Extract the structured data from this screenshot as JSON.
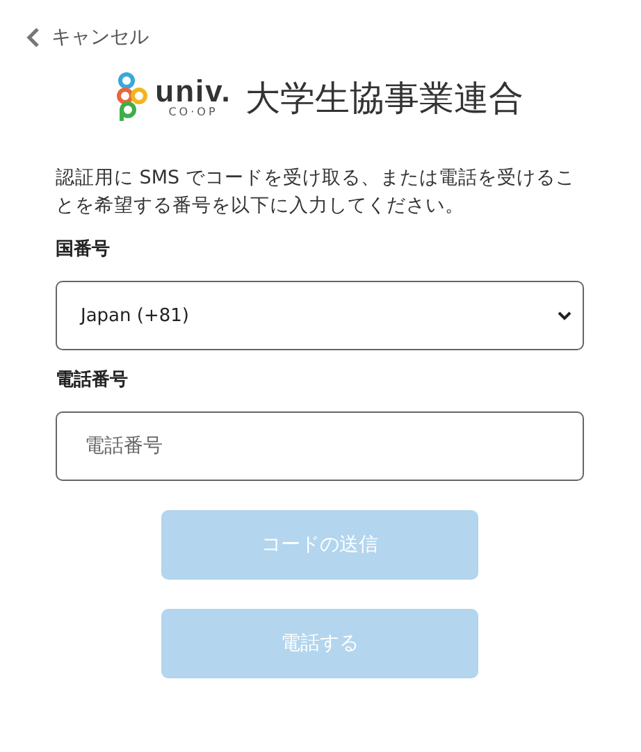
{
  "cancel_link": {
    "label": "キャンセル"
  },
  "logo": {
    "wordmark": "univ.",
    "subtext": "CO·OP",
    "name": "大学生協事業連合"
  },
  "instructions": "認証用に SMS でコードを受け取る、または電話を受けることを希望する番号を以下に入力してください。",
  "country_field": {
    "label": "国番号",
    "value": "Japan (+81)"
  },
  "phone_field": {
    "label": "電話番号",
    "placeholder": "電話番号"
  },
  "buttons": [
    {
      "label": "コードの送信",
      "disabled": true
    },
    {
      "label": "電話する",
      "disabled": true
    }
  ]
}
